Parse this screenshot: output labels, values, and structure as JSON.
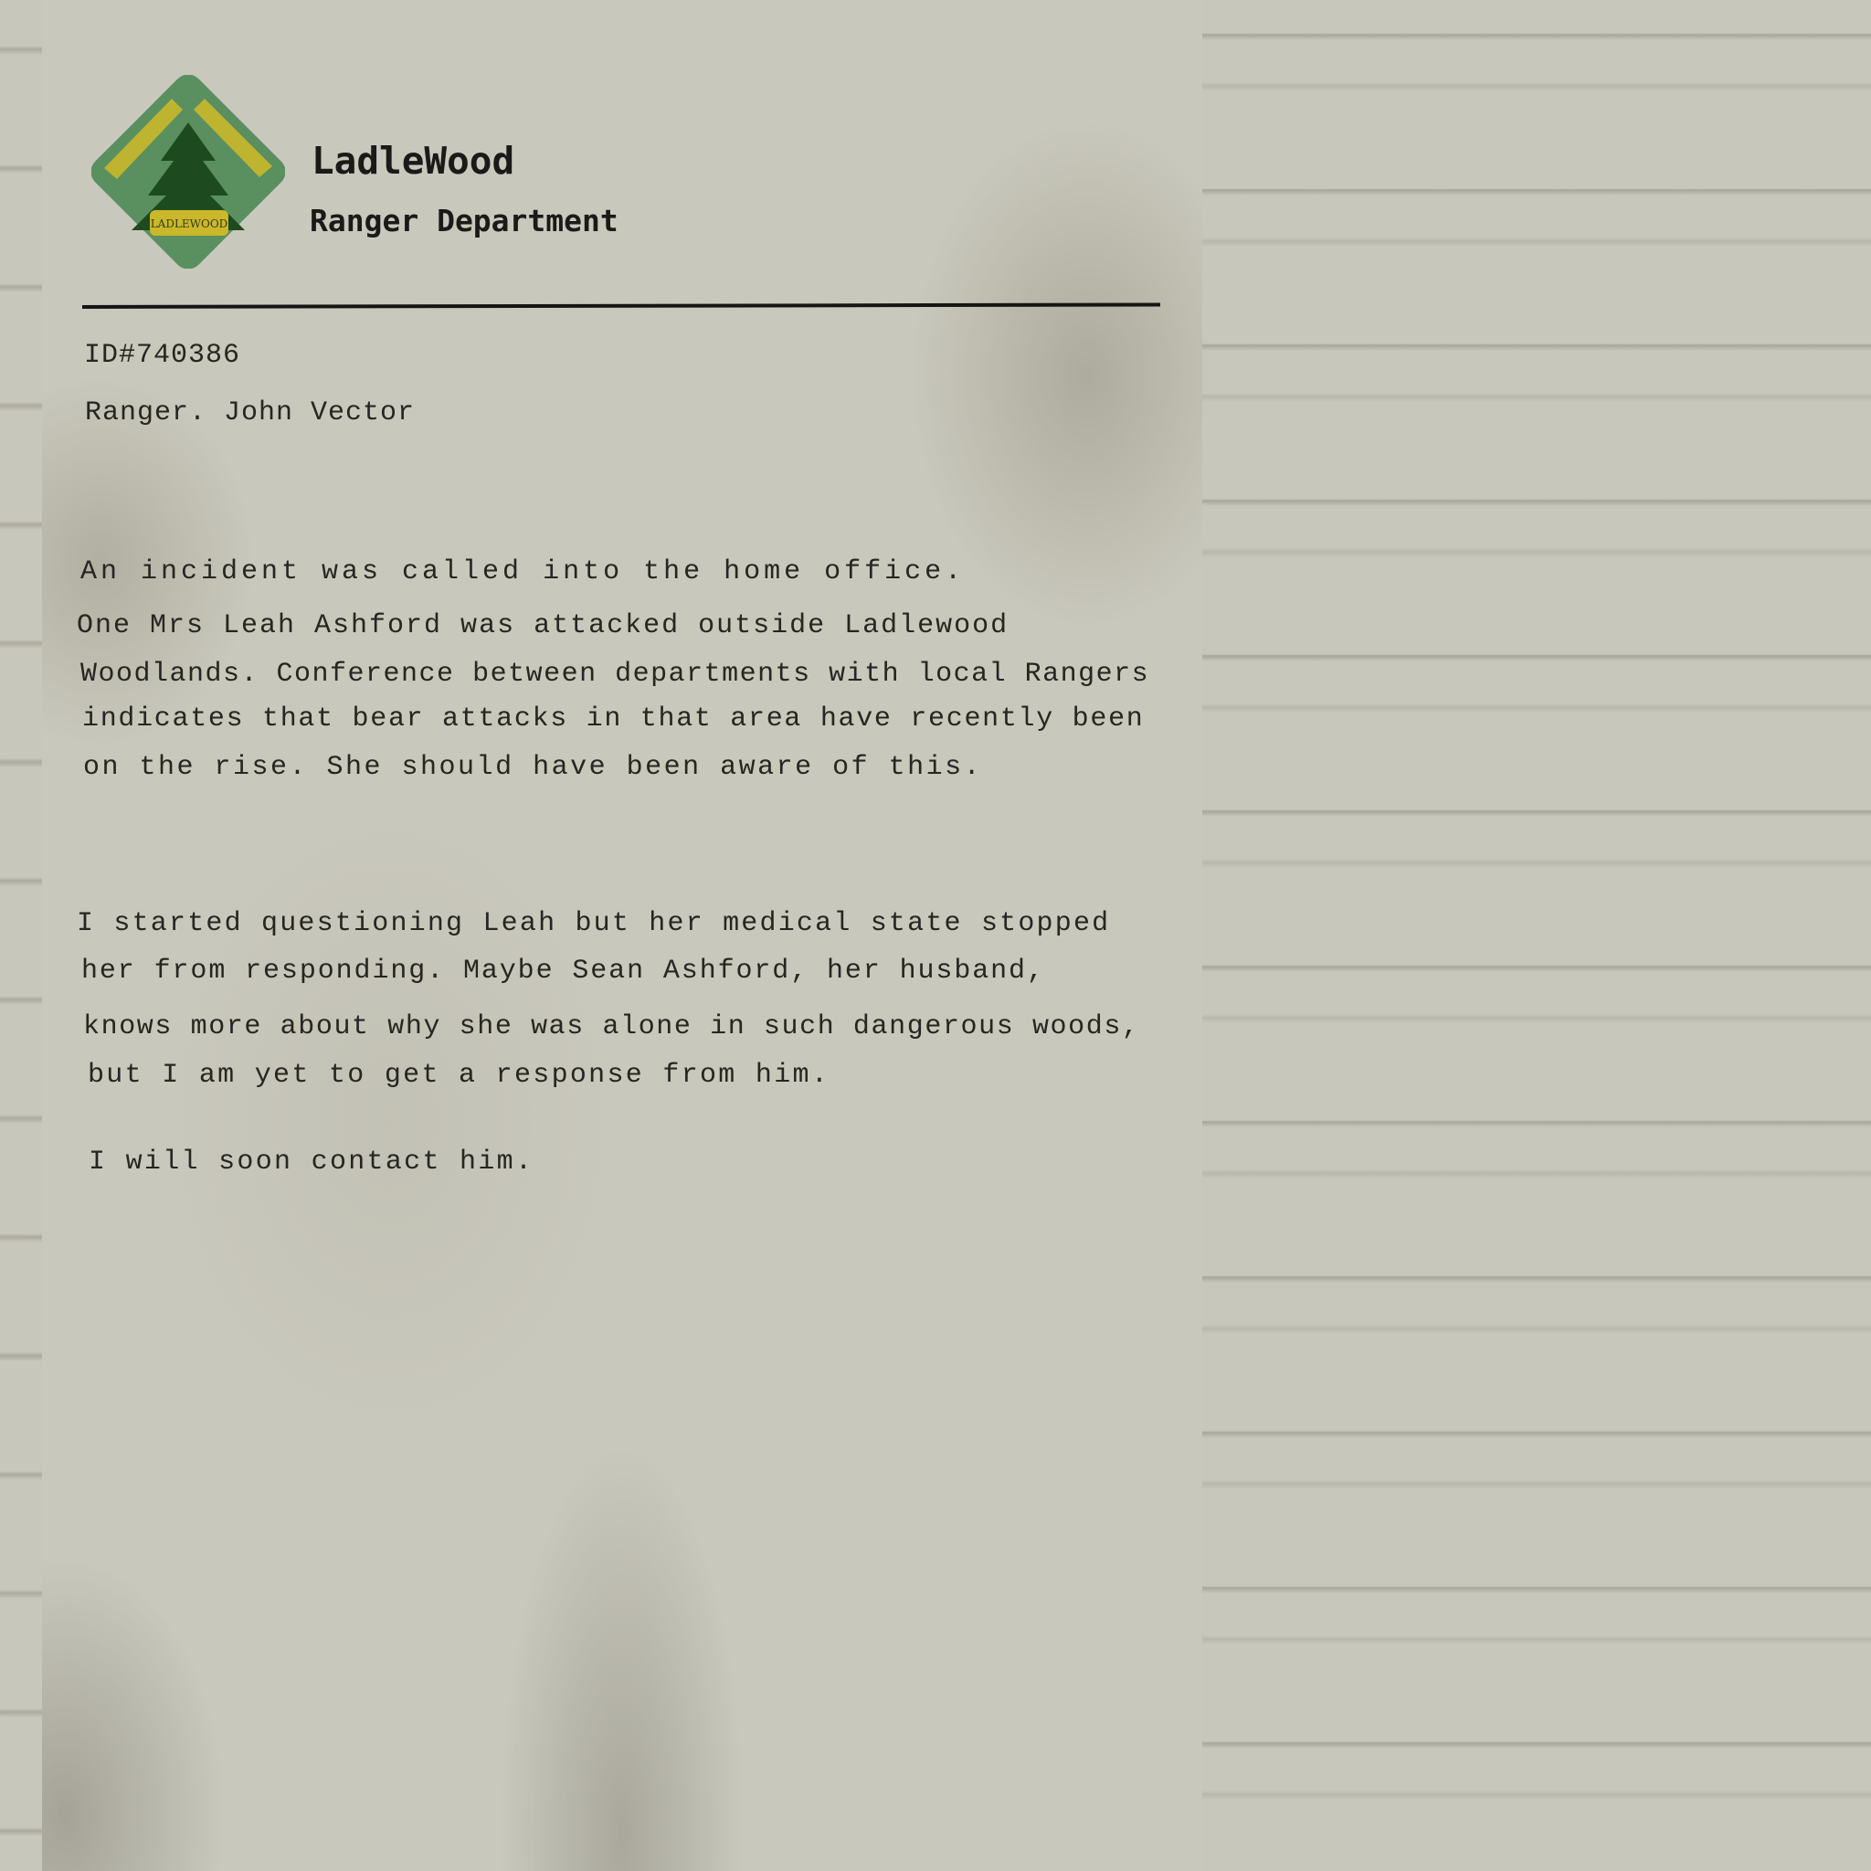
{
  "header": {
    "org_name": "LadleWood",
    "department": "Ranger Department",
    "logo_badge_text": "LADLEWOOD"
  },
  "meta": {
    "id": "ID#740386",
    "author": "Ranger. John Vector"
  },
  "body": {
    "lines": [
      "An incident was called  into  the  home office.",
      "One Mrs  Leah Ashford was attacked outside Ladlewood",
      "Woodlands. Conference between departments with local Rangers",
      "indicates that bear attacks in that area have recently been",
      "on the rise. She should  have been aware of this.",
      "I started questioning Leah but her medical state stopped",
      "her from responding. Maybe Sean Ashford, her husband,",
      "knows more about why she was alone in such dangerous woods,",
      "but I am yet to get a response from him.",
      "I will soon contact him."
    ]
  },
  "colors": {
    "paper": "#c9c8bc",
    "ink": "#262622",
    "logo_green": "#5a8f60",
    "logo_dark_green": "#1d4a1f",
    "logo_yellow": "#c9b82a"
  }
}
